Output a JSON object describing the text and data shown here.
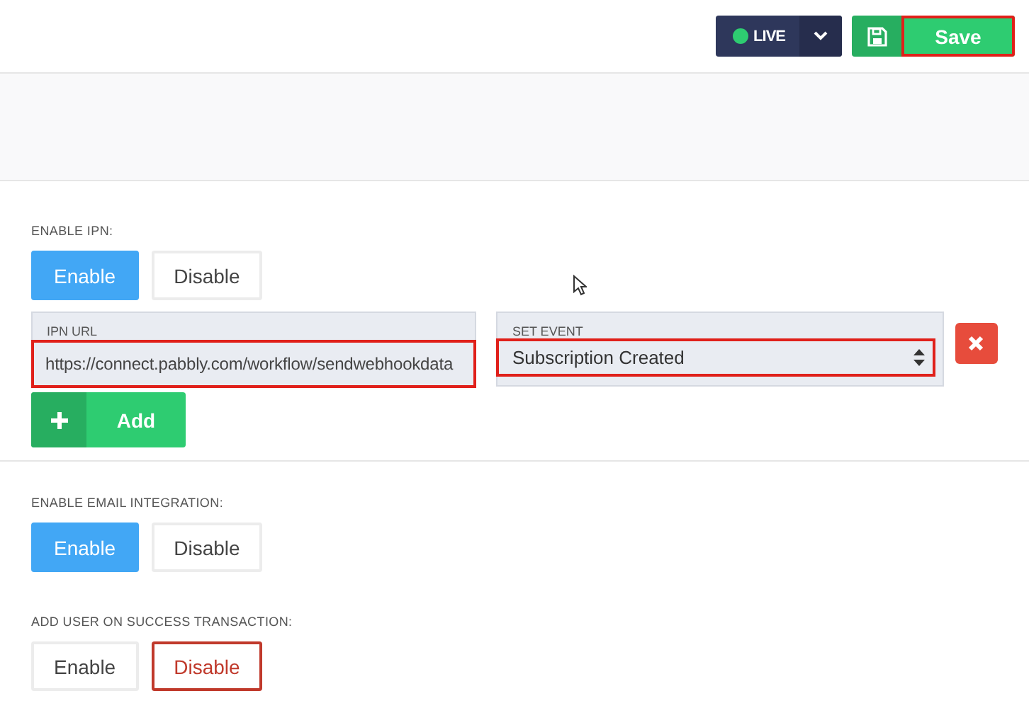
{
  "toolbar": {
    "status": {
      "label": "LIVE",
      "live": true
    },
    "save": {
      "label": "Save",
      "highlighted": true
    }
  },
  "sections": [
    {
      "label": "ENABLE IPN:",
      "options": [
        {
          "label": "Enable",
          "kind": "enable",
          "selected": true
        },
        {
          "label": "Disable",
          "kind": "disable",
          "selected": false
        }
      ],
      "ipn": {
        "url_label": "IPN URL",
        "url": "https://connect.pabbly.com/workflow/sendwebhookdata",
        "url_highlighted": true,
        "event_label": "SET EVENT",
        "event": "Subscription Created",
        "event_highlighted": true,
        "add_label": "Add"
      }
    },
    {
      "label": "ENABLE EMAIL INTEGRATION:",
      "options": [
        {
          "label": "Enable",
          "kind": "enable",
          "selected": true
        },
        {
          "label": "Disable",
          "kind": "disable",
          "selected": false
        }
      ]
    },
    {
      "label": "ADD USER ON SUCCESS TRANSACTION:",
      "options": [
        {
          "label": "Enable",
          "kind": "enable",
          "selected": false
        },
        {
          "label": "Disable",
          "kind": "disable",
          "selected": true
        }
      ]
    }
  ]
}
